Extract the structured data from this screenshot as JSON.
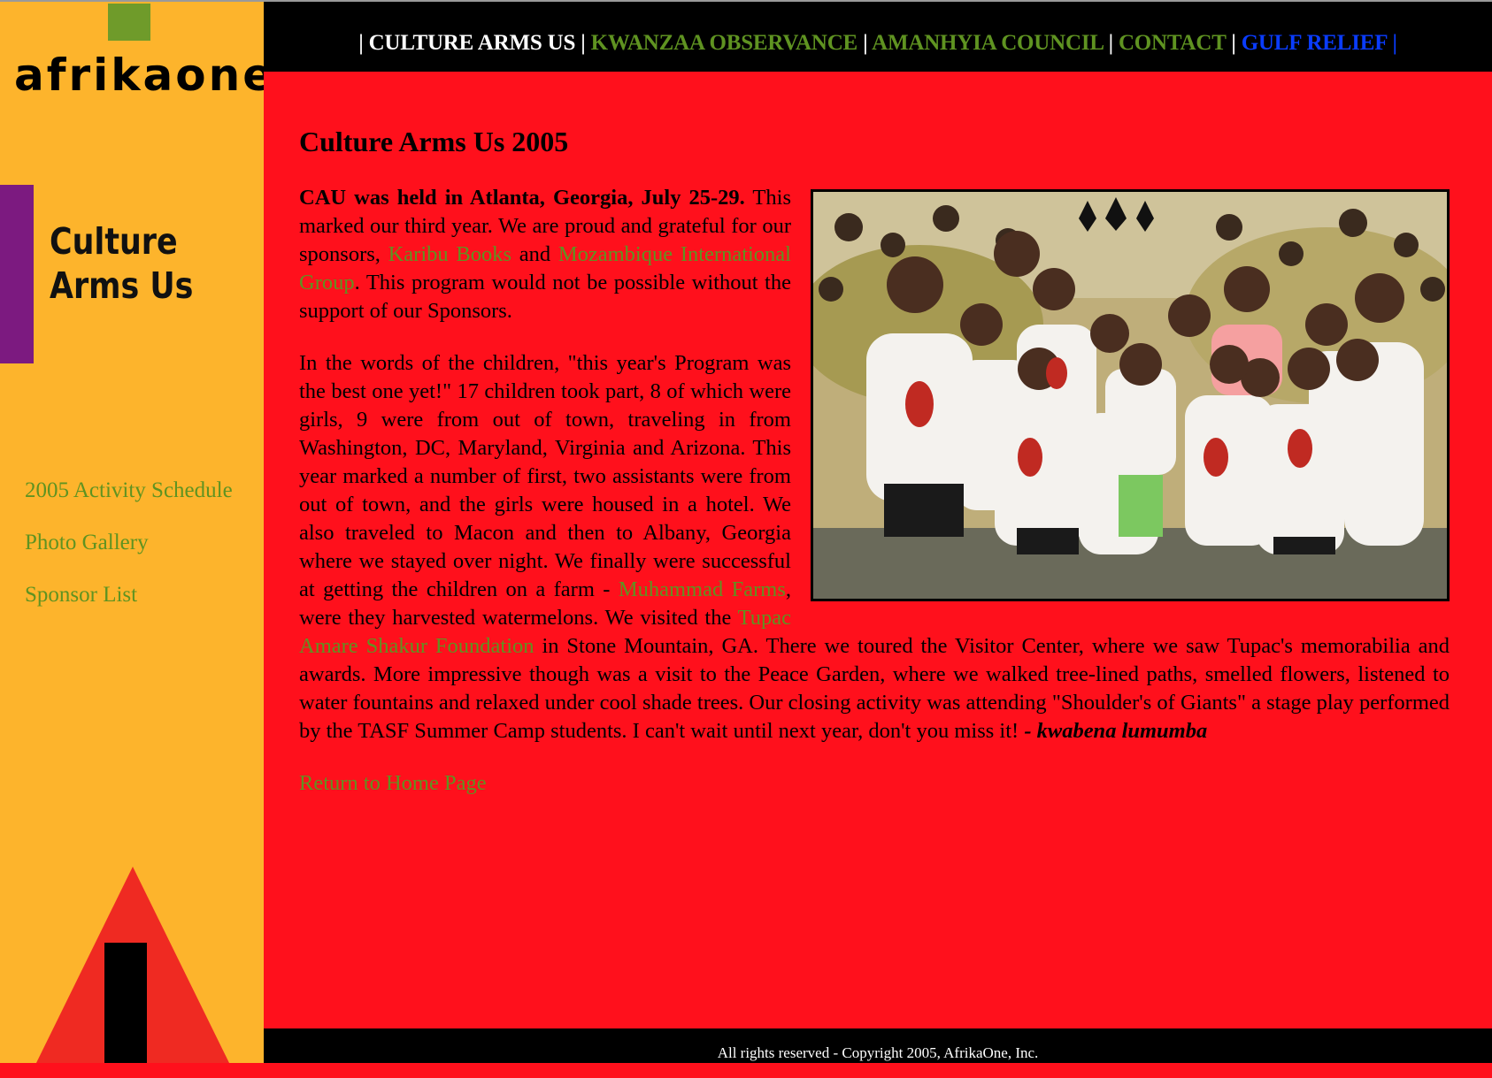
{
  "brand": {
    "logo_text": "afrikaone"
  },
  "sidebar": {
    "section_title_line1": "Culture",
    "section_title_line2": "Arms Us",
    "links": [
      "2005 Activity Schedule",
      "Photo Gallery",
      "Sponsor List"
    ]
  },
  "topnav": {
    "items": [
      "CULTURE ARMS US",
      "KWANZAA OBSERVANCE",
      "AMANHYIA COUNCIL",
      "CONTACT",
      "GULF RELIEF"
    ],
    "separator": "|"
  },
  "main": {
    "title": "Culture Arms Us 2005",
    "p1": {
      "lead": "CAU was held in Atlanta, Georgia, July 25-29.",
      "t1": " This marked our third year. We are proud and grateful for our sponsors, ",
      "link1": "Karibu Books",
      "t2": " and ",
      "link2": "Mozambique International Group",
      "t3": ". This program would not be possible without the support of our Sponsors."
    },
    "p2": {
      "t1": "In the words of the children, \"this year's Program was the best one yet!\" 17 children took part, 8 of which were girls, 9 were from out of town, traveling in from Washington, DC, Maryland, Virginia and Arizona. This year marked a number of first, two assistants were from out of town, and the girls were housed in a hotel. We also traveled to Macon and then to Albany, Georgia where we stayed over night. We finally were successful at getting the children on a farm - ",
      "link1": "Muhammad Farms",
      "t2": ", were they harvested watermelons. We visited the ",
      "link2": "Tupac Amare Shakur Foundation",
      "t3": " in Stone Mountain, GA. There we toured the Visitor Center, where we saw Tupac's memorabilia and awards. More impressive though was a visit to the Peace Garden, where we walked tree-lined paths, smelled flowers, listened to water fountains and relaxed under cool shade trees. Our closing activity was attending \"Shoulder's of Giants\" a stage play performed by the TASF Summer Camp students. I can't wait until next year, don't you miss it! ",
      "signature": "- kwabena lumumba"
    },
    "return_link": "Return to Home Page"
  },
  "footer": {
    "copyright": "All rights reserved - Copyright 2005, AfrikaOne, Inc."
  },
  "colors": {
    "background_red": "#ff101c",
    "sidebar_orange": "#fdb42c",
    "link_green": "#5f9321",
    "nav_blue": "#0a3cff",
    "accent_purple": "#7c1a80"
  }
}
